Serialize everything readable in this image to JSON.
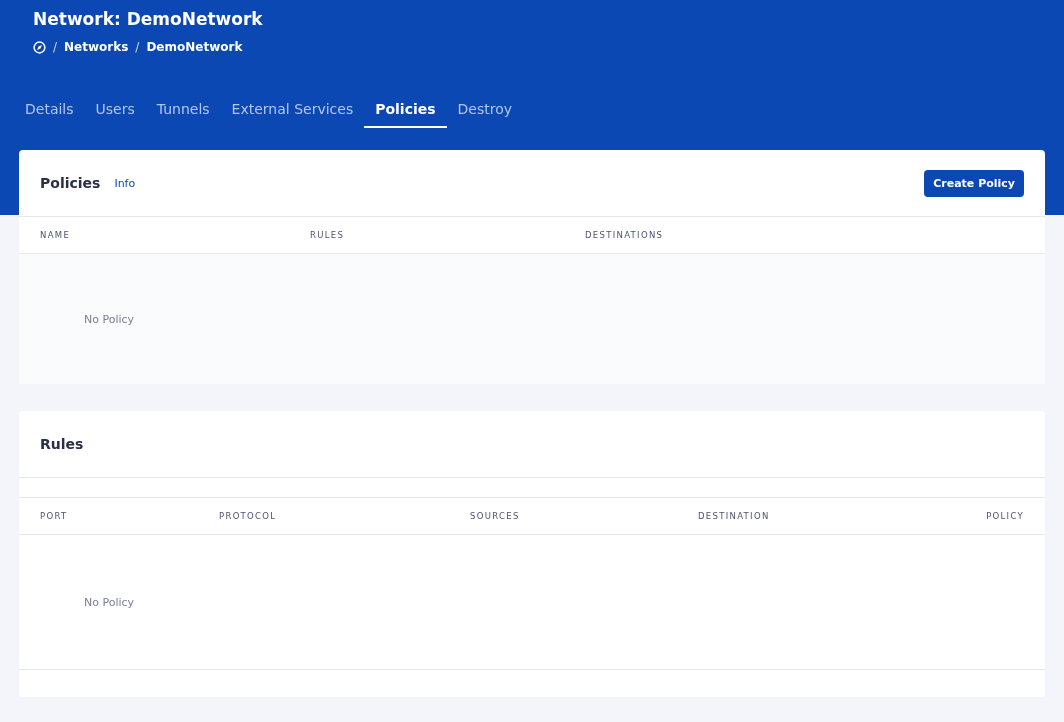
{
  "header": {
    "title": "Network: DemoNetwork",
    "breadcrumbs": [
      {
        "separator": "/",
        "label": "Networks"
      },
      {
        "separator": "/",
        "label": "DemoNetwork"
      }
    ]
  },
  "tabs": [
    {
      "label": "Details",
      "selected": false
    },
    {
      "label": "Users",
      "selected": false
    },
    {
      "label": "Tunnels",
      "selected": false
    },
    {
      "label": "External Services",
      "selected": false
    },
    {
      "label": "Policies",
      "selected": true
    },
    {
      "label": "Destroy",
      "selected": false
    }
  ],
  "policies": {
    "title": "Policies",
    "info_link": "Info",
    "button": "Create Policy",
    "columns": [
      "NAME",
      "RULES",
      "DESTINATIONS"
    ],
    "empty_text": "No Policy"
  },
  "rules": {
    "title": "Rules",
    "columns": [
      "PORT",
      "PROTOCOL",
      "SOURCES",
      "DESTINATION",
      "POLICY"
    ],
    "empty_text": "No Policy"
  }
}
